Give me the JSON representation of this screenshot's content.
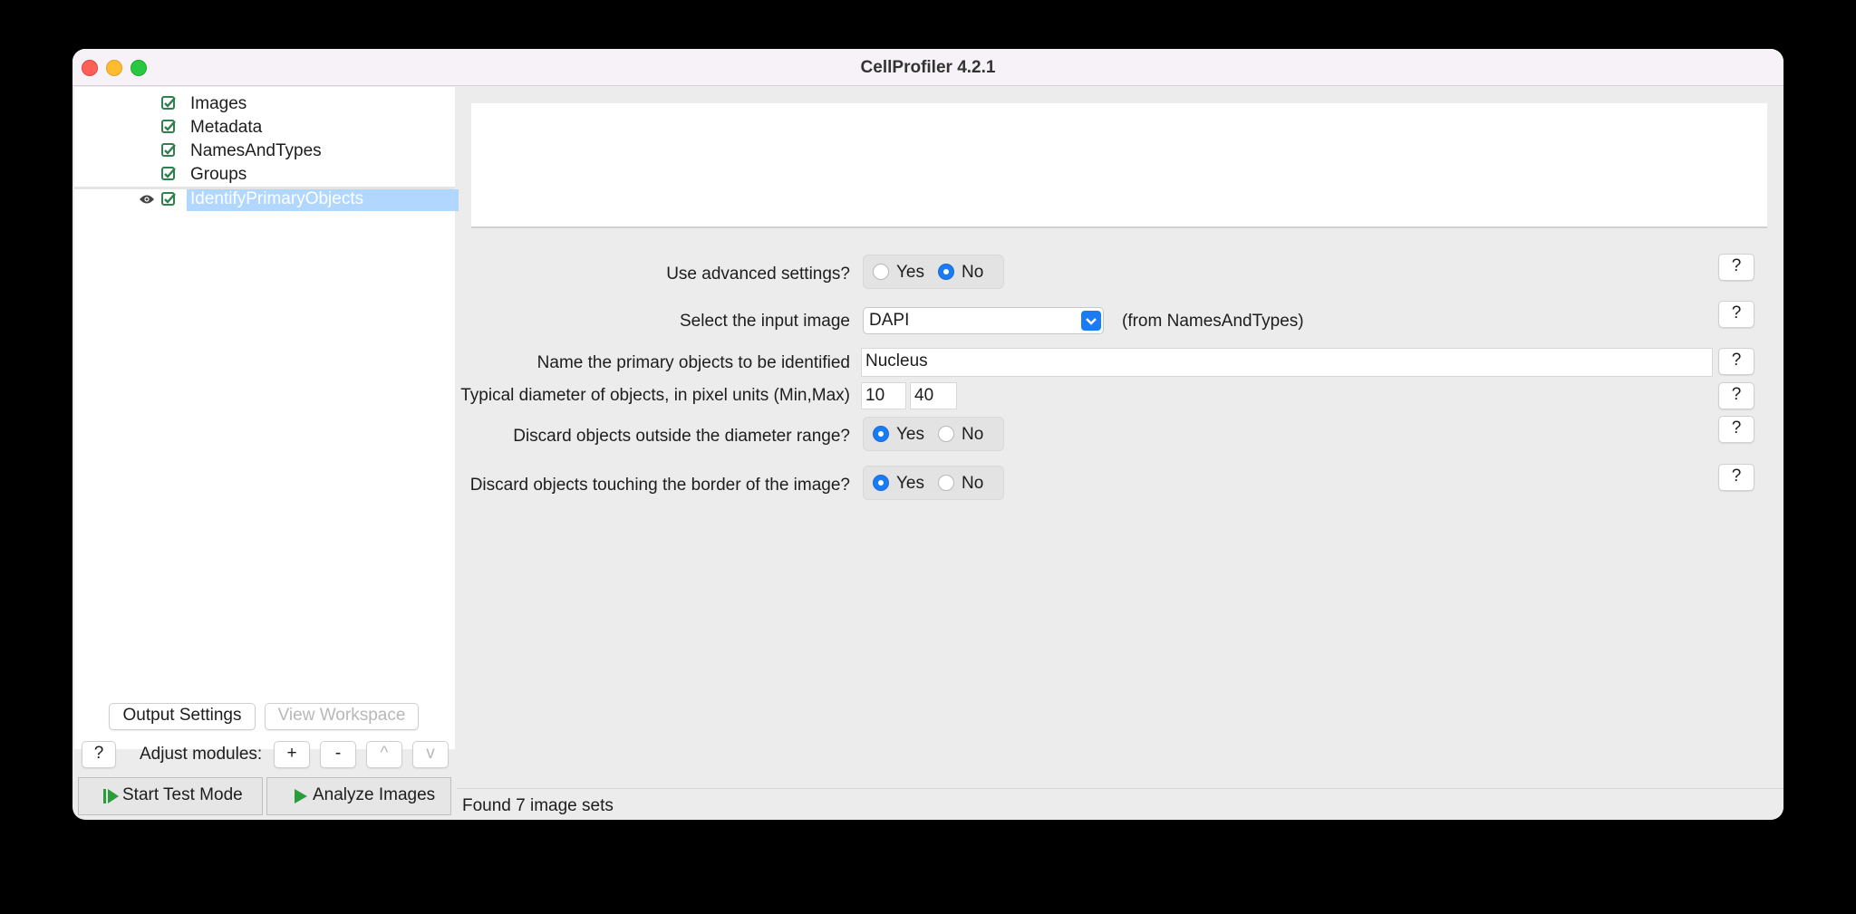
{
  "window": {
    "title": "CellProfiler 4.2.1"
  },
  "pipeline": {
    "modules": [
      {
        "name": "Images",
        "checked": true,
        "selected": false,
        "eye": false
      },
      {
        "name": "Metadata",
        "checked": true,
        "selected": false,
        "eye": false
      },
      {
        "name": "NamesAndTypes",
        "checked": true,
        "selected": false,
        "eye": false
      },
      {
        "name": "Groups",
        "checked": true,
        "selected": false,
        "eye": false
      },
      {
        "name": "IdentifyPrimaryObjects",
        "checked": true,
        "selected": true,
        "eye": true
      }
    ]
  },
  "left_controls": {
    "output_settings": "Output Settings",
    "view_workspace": "View Workspace",
    "help": "?",
    "adjust_label": "Adjust modules:",
    "add": "+",
    "remove": "-",
    "up": "^",
    "down": "v",
    "start_test_mode": "Start Test Mode",
    "analyze_images": "Analyze Images"
  },
  "settings": {
    "advanced": {
      "label": "Use advanced settings?",
      "yes": "Yes",
      "no": "No",
      "value": "No"
    },
    "input_image": {
      "label": "Select the input image",
      "value": "DAPI",
      "source_note": "(from NamesAndTypes)"
    },
    "object_name": {
      "label": "Name the primary objects to be identified",
      "value": "Nucleus"
    },
    "diameter": {
      "label": "Typical diameter of objects, in pixel units (Min,Max)",
      "min": "10",
      "max": "40"
    },
    "discard_outside": {
      "label": "Discard objects outside the diameter range?",
      "yes": "Yes",
      "no": "No",
      "value": "Yes"
    },
    "discard_border": {
      "label": "Discard objects touching the border of the image?",
      "yes": "Yes",
      "no": "No",
      "value": "Yes"
    },
    "help": "?"
  },
  "status": {
    "text": "Found 7 image sets"
  },
  "colors": {
    "accent": "#1a7cf5",
    "selection": "#b2d7ff",
    "check": "#2f7f4f"
  }
}
